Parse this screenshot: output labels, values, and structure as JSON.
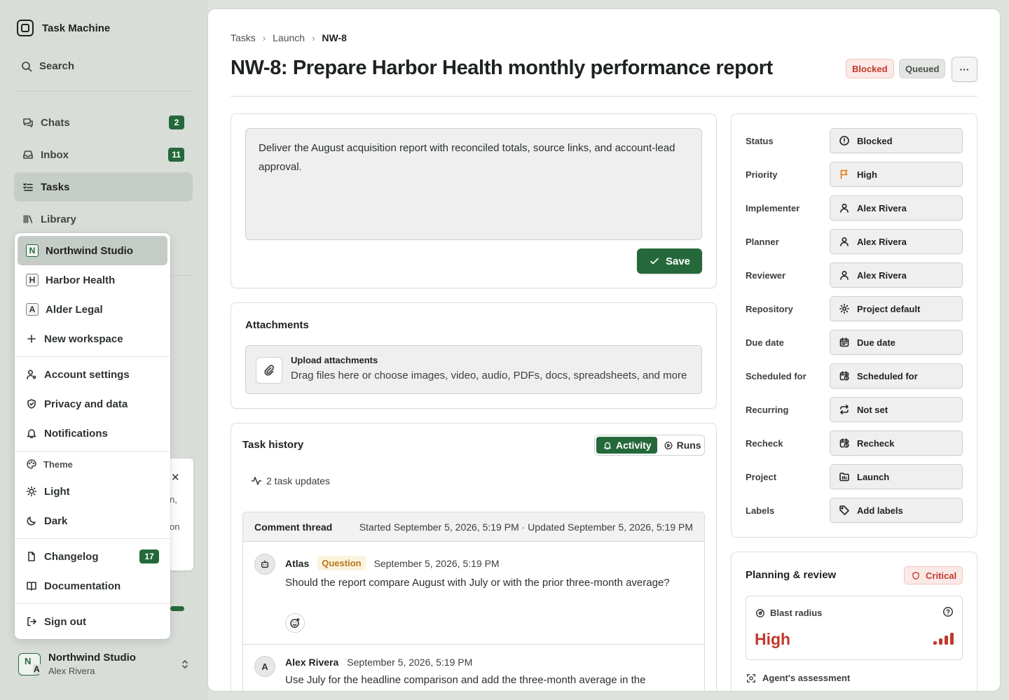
{
  "app": {
    "name": "Task Machine"
  },
  "sidebar": {
    "search_label": "Search",
    "items": [
      {
        "label": "Chats",
        "badge": "2"
      },
      {
        "label": "Inbox",
        "badge": "11"
      },
      {
        "label": "Tasks",
        "badge": null
      },
      {
        "label": "Library",
        "badge": null
      }
    ],
    "workspace_footer": {
      "name": "Northwind Studio",
      "user": "Alex Rivera",
      "avatar_letters": [
        "N",
        "A"
      ]
    },
    "background_card": {
      "t1": "n,",
      "t2": "on"
    }
  },
  "menu": {
    "workspaces": [
      {
        "letter": "N",
        "label": "Northwind Studio",
        "selected": true
      },
      {
        "letter": "H",
        "label": "Harbor Health"
      },
      {
        "letter": "A",
        "label": "Alder Legal"
      }
    ],
    "new_workspace": "New workspace",
    "account": [
      "Account settings",
      "Privacy and data",
      "Notifications"
    ],
    "theme_heading": "Theme",
    "themes": [
      "Light",
      "Dark"
    ],
    "changelog": {
      "label": "Changelog",
      "badge": "17"
    },
    "documentation": "Documentation",
    "sign_out": "Sign out"
  },
  "header": {
    "breadcrumb": [
      "Tasks",
      "Launch",
      "NW-8"
    ],
    "title": "NW-8: Prepare Harbor Health monthly performance report",
    "status_pills": [
      "Blocked",
      "Queued"
    ],
    "more_label": "···"
  },
  "description": {
    "text": "Deliver the August acquisition report with reconciled totals, source links, and account-lead approval.",
    "save_label": "Save"
  },
  "attachments": {
    "title": "Attachments",
    "upload_title": "Upload attachments",
    "upload_hint": "Drag files here or choose images, video, audio, PDFs, docs, spreadsheets, and more"
  },
  "history": {
    "title": "Task history",
    "tabs": [
      "Activity",
      "Runs"
    ],
    "active_tab": "Activity",
    "updates": "2 task updates",
    "thread": {
      "label": "Comment thread",
      "meta": "Started September 5, 2026, 5:19 PM · Updated September 5, 2026, 5:19 PM",
      "comments": [
        {
          "author": "Atlas",
          "tag": "Question",
          "date": "September 5, 2026, 5:19 PM",
          "avatar": "",
          "body": "Should the report compare August with July or with the prior three-month average?"
        },
        {
          "author": "Alex Rivera",
          "date": "September 5, 2026, 5:19 PM",
          "avatar": "A",
          "body": "Use July for the headline comparison and add the three-month average in the"
        }
      ]
    }
  },
  "properties": [
    {
      "label": "Status",
      "value": "Blocked",
      "icon": "circle-status-icon"
    },
    {
      "label": "Priority",
      "value": "High",
      "icon": "flag-icon"
    },
    {
      "label": "Implementer",
      "value": "Alex Rivera",
      "icon": "user-icon"
    },
    {
      "label": "Planner",
      "value": "Alex Rivera",
      "icon": "user-icon"
    },
    {
      "label": "Reviewer",
      "value": "Alex Rivera",
      "icon": "user-icon"
    },
    {
      "label": "Repository",
      "value": "Project default",
      "icon": "gear-icon"
    },
    {
      "label": "Due date",
      "value": "Due date",
      "icon": "calendar-icon"
    },
    {
      "label": "Scheduled for",
      "value": "Scheduled for",
      "icon": "calendar-clock-icon"
    },
    {
      "label": "Recurring",
      "value": "Not set",
      "icon": "repeat-icon"
    },
    {
      "label": "Recheck",
      "value": "Recheck",
      "icon": "calendar-clock-icon"
    },
    {
      "label": "Project",
      "value": "Launch",
      "icon": "folder-icon"
    },
    {
      "label": "Labels",
      "value": "Add labels",
      "icon": "tag-icon"
    }
  ],
  "planning": {
    "title": "Planning & review",
    "severity": "Critical",
    "blast_label": "Blast radius",
    "blast_value": "High",
    "assessment_label": "Agent's assessment"
  },
  "colors": {
    "accent": "#25693a",
    "danger": "#c0392b",
    "warning": "#e07b00"
  }
}
